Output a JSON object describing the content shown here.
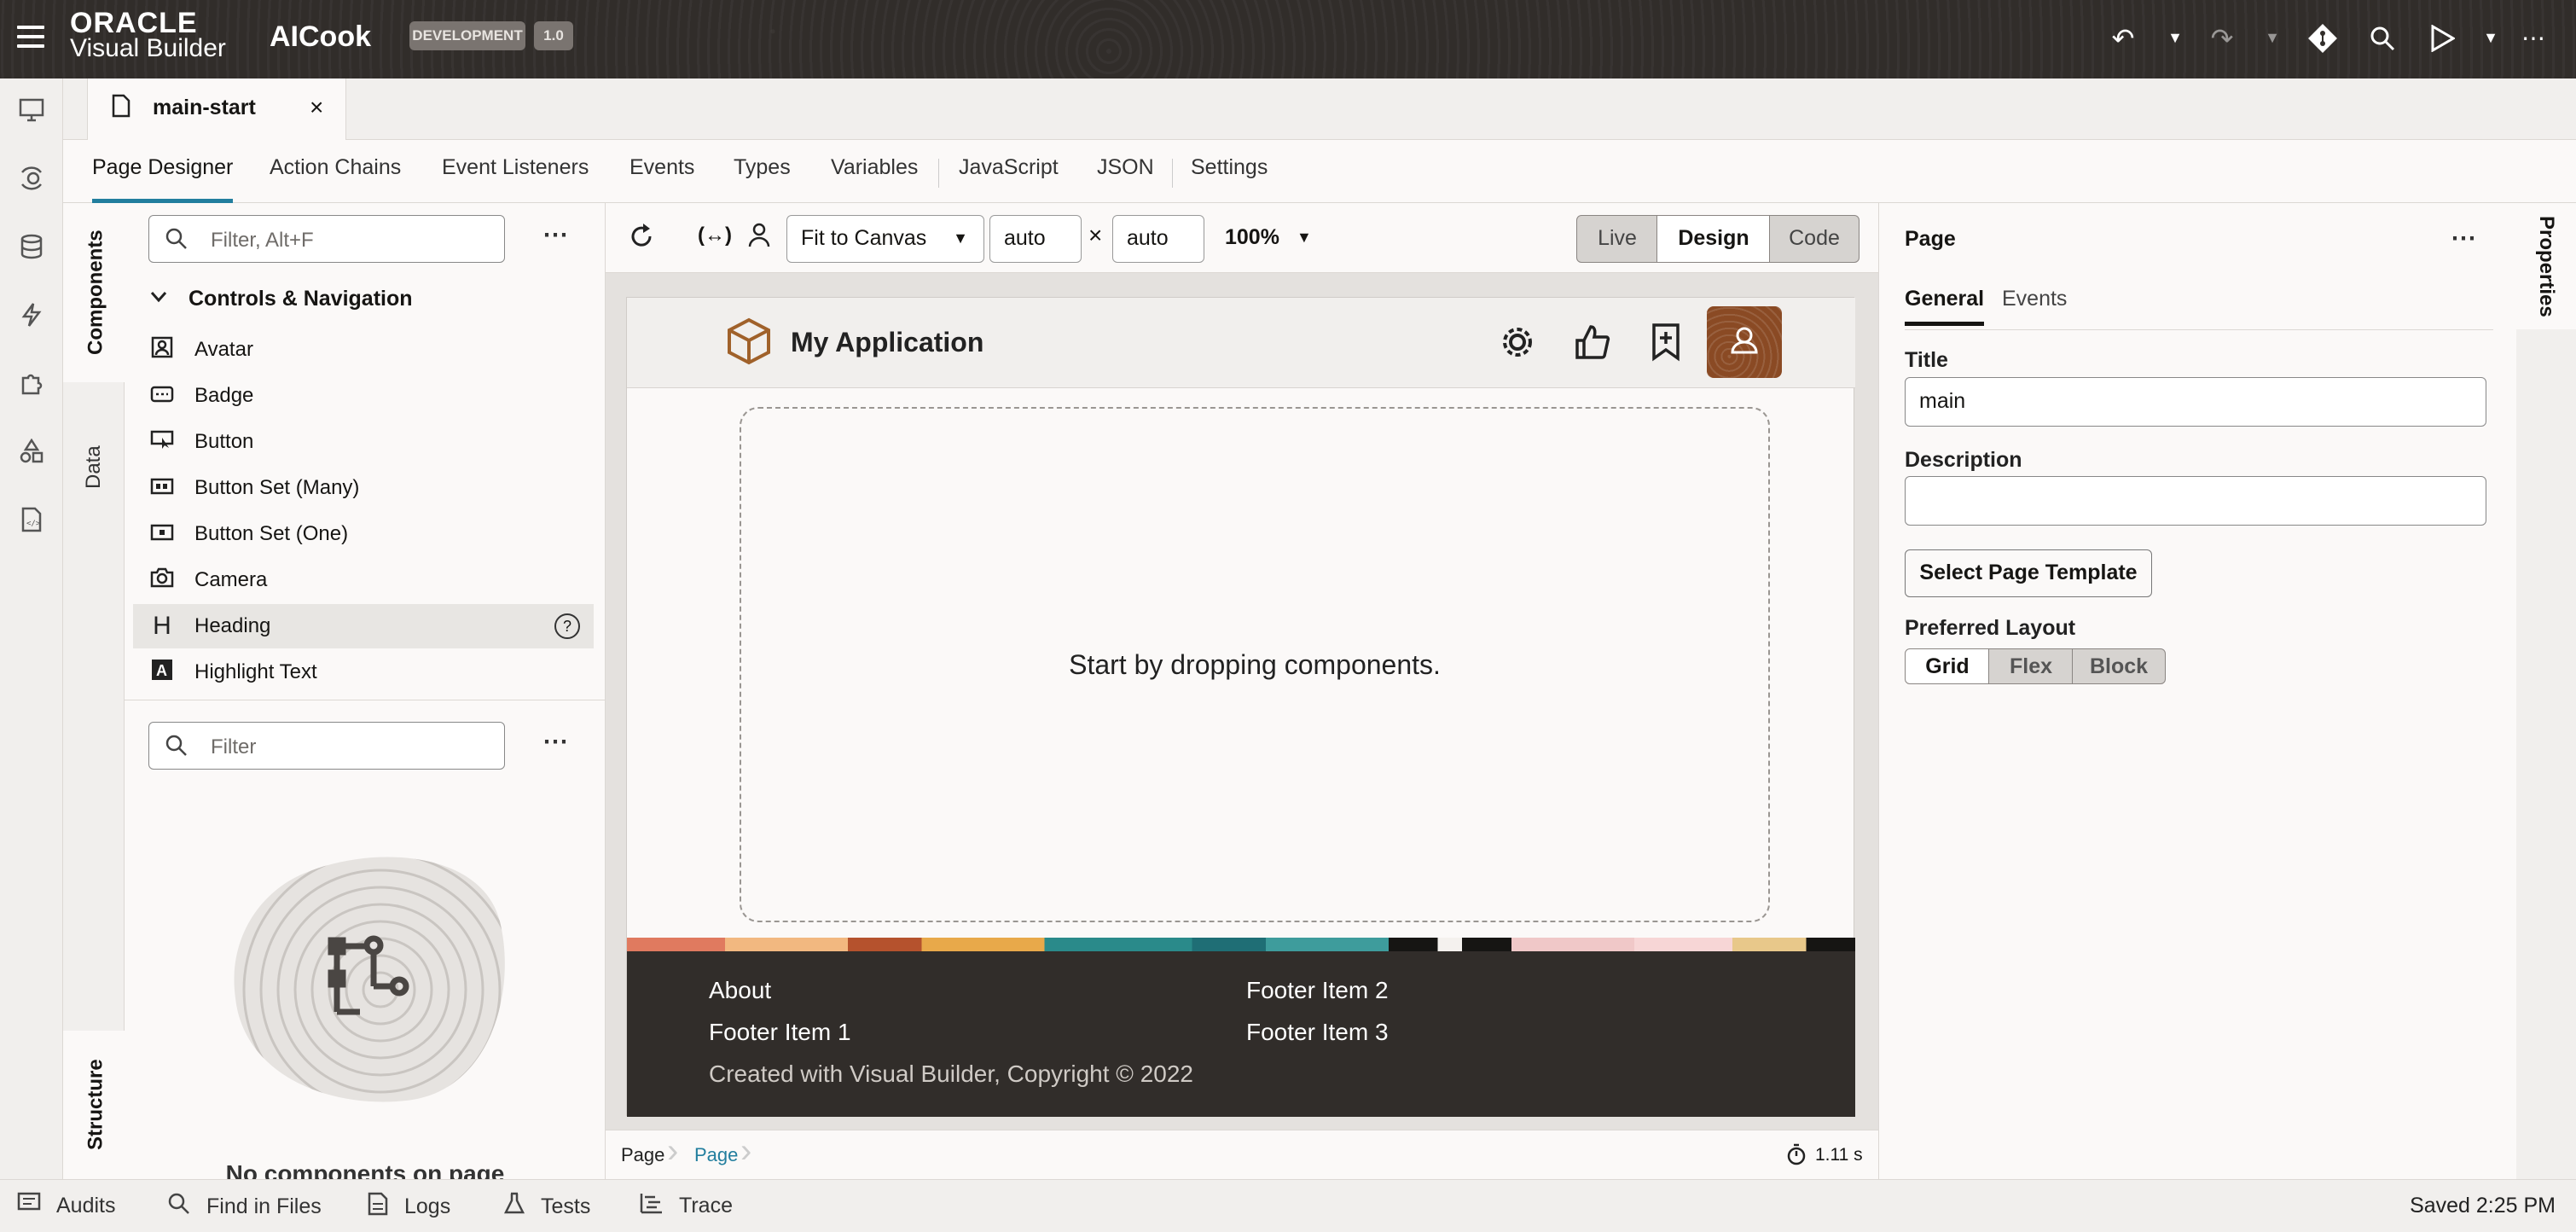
{
  "topbar": {
    "brand_top": "ORACLE",
    "brand_bottom": "Visual Builder",
    "app_name": "AICook",
    "env_badge": "DEVELOPMENT",
    "version_badge": "1.0"
  },
  "file_tab": {
    "label": "main-start"
  },
  "nav_tabs": [
    "Page Designer",
    "Action Chains",
    "Event Listeners",
    "Events",
    "Types",
    "Variables",
    "JavaScript",
    "JSON",
    "Settings"
  ],
  "side_tabs": {
    "components": "Components",
    "data": "Data",
    "structure": "Structure"
  },
  "components": {
    "filter_placeholder": "Filter, Alt+F",
    "section_title": "Controls & Navigation",
    "items": [
      "Avatar",
      "Badge",
      "Button",
      "Button Set (Many)",
      "Button Set (One)",
      "Camera",
      "Heading",
      "Highlight Text"
    ]
  },
  "structure": {
    "filter_placeholder": "Filter",
    "empty_text": "No components on page"
  },
  "canvas_toolbar": {
    "fit": "Fit to Canvas",
    "width": "auto",
    "times": "×",
    "height": "auto",
    "zoom": "100%",
    "modes": [
      "Live",
      "Design",
      "Code"
    ]
  },
  "app_preview": {
    "title": "My Application",
    "drop_hint": "Start by dropping components.",
    "footer": {
      "about": "About",
      "item1": "Footer Item 1",
      "item2": "Footer Item 2",
      "item3": "Footer Item 3",
      "copyright": "Created with Visual Builder, Copyright © 2022"
    }
  },
  "breadcrumb": [
    "Page",
    "Page"
  ],
  "timer": "1.11 s",
  "properties": {
    "header": "Page",
    "tabs": [
      "General",
      "Events"
    ],
    "title_label": "Title",
    "title_value": "main",
    "description_label": "Description",
    "description_value": "",
    "template_button": "Select Page Template",
    "layout_label": "Preferred Layout",
    "layout_options": [
      "Grid",
      "Flex",
      "Block"
    ],
    "side_tab": "Properties"
  },
  "bottom_bar": {
    "items": [
      "Audits",
      "Find in Files",
      "Logs",
      "Tests",
      "Trace"
    ],
    "status": "Saved 2:25 PM"
  },
  "colors": {
    "accent": "#227e9e",
    "topbar": "#312d2a",
    "footer": "#312d2a",
    "avatar_bg": "#8a4a24"
  }
}
